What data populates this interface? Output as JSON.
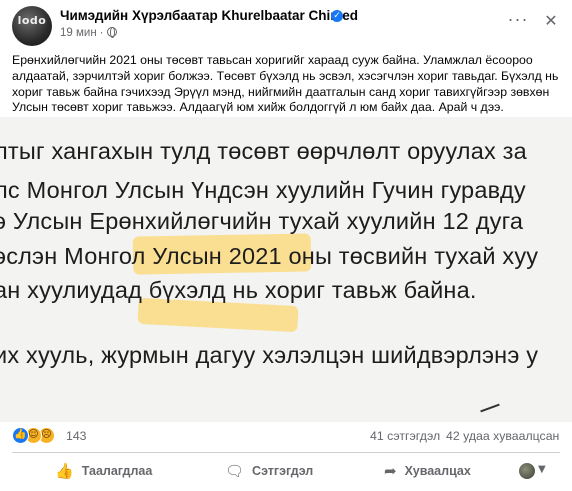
{
  "post": {
    "author": "Чимэдийн Хүрэлбаатар Khurelbaatar Chimed",
    "time": "19 мин",
    "avatar_text": "lodo",
    "text": "Ерөнхийлөгчийн 2021 оны төсөвт тавьсан хоригийг хараад сууж байна. Уламжлал ёсоороо алдаатай, зэрчилтэй хориг болжээ. Төсөвт бүхэлд нь эсвэл, хэсэгчлэн хориг тавьдаг. Бүхэлд нь хориг тавьж байна гэчихээд Эрүүл мэнд, нийгмийн даатгалын санд хориг тавихгүйгээр зөвхөн Улсын төсөвт хориг тавьжээ.    Алдаагүй юм хийж болдоггүй л юм байх даа. Арай ч дээ.",
    "image_lines": [
      "лтыг хангахын тулд төсөвт өөрчлөлт оруулах за",
      "лс  Монгол Улсын Үндсэн хуулийн Гучин гуравду",
      "э Улсын Ерөнхийлөгчийн тухай хуулийн 12 дуга",
      "эслэн Монгол Улсын 2021 оны төсвийн тухай хуу",
      "ан хуулиудад бүхэлд нь хориг тавьж байна.",
      "их хууль, журмын дагуу хэлэлцэн шийдвэрлэнэ у"
    ]
  },
  "stats": {
    "reaction_count": "143",
    "comments": "41 сэтгэгдэл",
    "shares": "42 удаа хуваалцсан"
  },
  "actions": {
    "like": "Таалагдлаа",
    "comment": "Сэтгэгдэл",
    "share": "Хуваалцах"
  },
  "icons": {
    "like": "like-icon",
    "haha": "haha-icon",
    "sad": "sad-icon",
    "verified": "verified-icon",
    "more": "more-icon",
    "close": "close-icon",
    "privacy": "globe-icon"
  },
  "colors": {
    "brand": "#1877f2",
    "secondary_text": "#65676b",
    "highlight": "#ffce46"
  }
}
